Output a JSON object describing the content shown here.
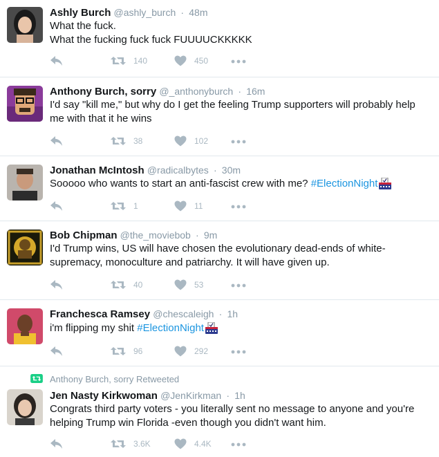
{
  "tweets": [
    {
      "name": "Ashly Burch",
      "handle": "@ashly_burch",
      "time": "48m",
      "lines": [
        "What the fuck.",
        "What the fucking fuck fuck FUUUUCKKKKK"
      ],
      "retweets": "140",
      "likes": "450"
    },
    {
      "name": "Anthony Burch, sorry",
      "handle": "@_anthonyburch",
      "time": "16m",
      "lines": [
        "I'd say \"kill me,\" but why do I get the feeling Trump supporters will probably help",
        "me with that it he wins"
      ],
      "retweets": "38",
      "likes": "102"
    },
    {
      "name": "Jonathan McIntosh",
      "handle": "@radicalbytes",
      "time": "30m",
      "text": "Sooooo who wants to start an anti-fascist crew with me? ",
      "hashtag": "#ElectionNight",
      "retweets": "1",
      "likes": "11"
    },
    {
      "name": "Bob Chipman",
      "handle": "@the_moviebob",
      "time": "9m",
      "lines": [
        "I'd Trump wins, US will have chosen the evolutionary dead-ends of white-",
        "supremacy, monoculture and patriarchy. It will have given up."
      ],
      "retweets": "40",
      "likes": "53"
    },
    {
      "name": "Franchesca Ramsey",
      "handle": "@chescaleigh",
      "time": "1h",
      "text": "i'm flipping my shit ",
      "hashtag": "#ElectionNight",
      "retweets": "96",
      "likes": "292"
    },
    {
      "retweet_context": "Anthony Burch, sorry Retweeted",
      "name": "Jen Nasty Kirkwoman",
      "handle": "@JenKirkman",
      "time": "1h",
      "lines": [
        "Congrats third party voters - you literally sent no message to anyone and you're",
        "helping Trump win Florida -even though you didn't want him."
      ],
      "retweets": "3.6K",
      "likes": "4.4K"
    }
  ],
  "colors": {
    "text": "#14171a",
    "secondary": "#8899a6",
    "action": "#aab8c2",
    "hashtag": "#1b95e0",
    "retweet_green": "#19cf86",
    "divider": "#e1e8ed"
  },
  "icons": [
    "reply-icon",
    "retweet-icon",
    "like-icon",
    "more-icon",
    "ballot-box-icon"
  ]
}
